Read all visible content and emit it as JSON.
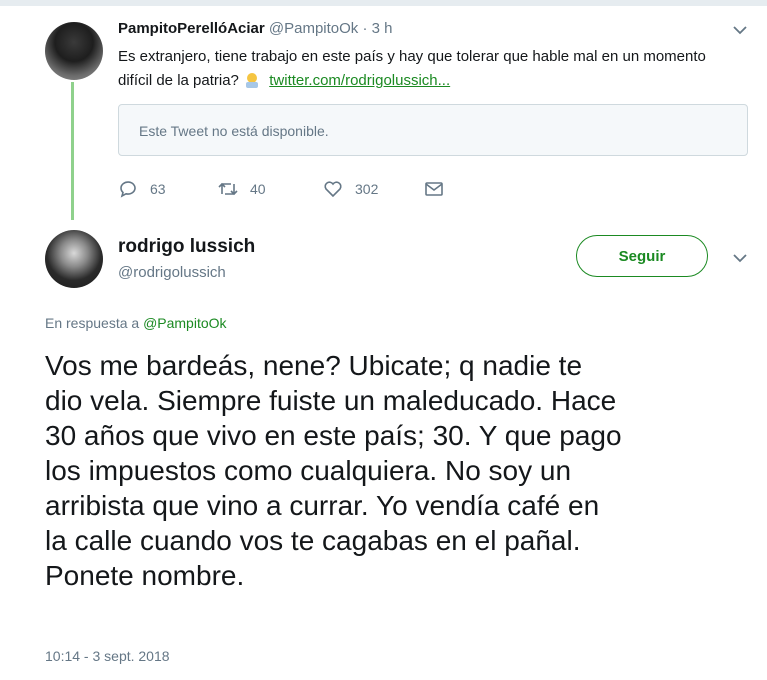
{
  "tweet1": {
    "display_name": "PampitoPerellóAciar",
    "handle": "@PampitoOk",
    "time": "3 h",
    "text": "Es extranjero, tiene trabajo en este país y hay que tolerar que hable mal en un momento difícil de la patria?",
    "link": "twitter.com/rodrigolussich...",
    "quoted_unavailable": "Este Tweet no está disponible.",
    "replies": "63",
    "retweets": "40",
    "likes": "302"
  },
  "tweet2": {
    "display_name": "rodrigo lussich",
    "handle": "@rodrigolussich",
    "follow_label": "Seguir",
    "reply_prefix": "En respuesta a",
    "reply_mention": "@PampitoOk",
    "body_lines": [
      "Vos me bardeás, nene? Ubicate; q nadie te",
      "dio vela. Siempre fuiste un maleducado. Hace",
      "30 años que vivo en este país; 30. Y que pago",
      "los impuestos como cualquiera. No soy un",
      "arribista que vino a currar. Yo vendía café en",
      "la calle cuando vos te cagabas en el pañal.",
      "Ponete nombre."
    ],
    "timestamp": "10:14 - 3 sept. 2018"
  },
  "colors": {
    "accent_green": "#1b8a22",
    "thread_line": "#8fd18c",
    "secondary_text": "#657786"
  },
  "icons": [
    "reply-icon",
    "retweet-icon",
    "like-icon",
    "dm-icon",
    "chevron-down-icon",
    "thinking-emoji-icon"
  ]
}
